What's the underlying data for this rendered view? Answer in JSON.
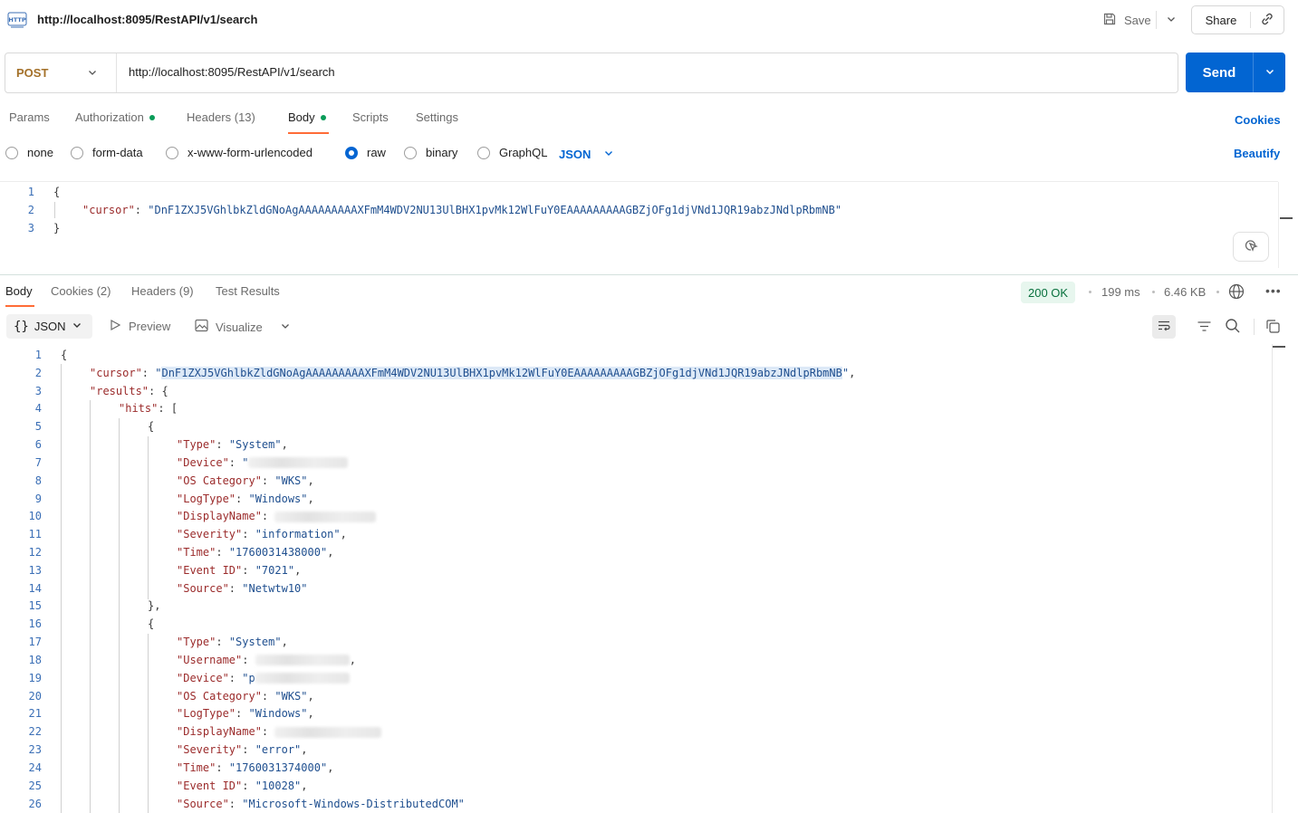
{
  "header": {
    "title": "http://localhost:8095/RestAPI/v1/search",
    "save_label": "Save",
    "share_label": "Share"
  },
  "request": {
    "method": "POST",
    "url": "http://localhost:8095/RestAPI/v1/search",
    "send_label": "Send",
    "tabs": [
      {
        "label": "Params",
        "dot": false
      },
      {
        "label": "Authorization",
        "dot": true
      },
      {
        "label": "Headers (13)",
        "dot": false
      },
      {
        "label": "Body",
        "dot": true
      },
      {
        "label": "Scripts",
        "dot": false
      },
      {
        "label": "Settings",
        "dot": false
      }
    ],
    "active_tab": "Body",
    "cookies_label": "Cookies",
    "body_modes": [
      "none",
      "form-data",
      "x-www-form-urlencoded",
      "raw",
      "binary",
      "GraphQL"
    ],
    "selected_mode": "raw",
    "language": "JSON",
    "beautify_label": "Beautify",
    "body_lines": [
      {
        "n": "1",
        "indent": 0,
        "text": "{"
      },
      {
        "n": "2",
        "indent": 1,
        "key": "cursor",
        "value": "DnF1ZXJ5VGhlbkZldGNoAgAAAAAAAAAXFmM4WDV2NU13UlBHX1pvMk12WlFuY0EAAAAAAAAAGBZjOFg1djVNd1JQR19abzJNdlpRbmNB",
        "trail": ""
      },
      {
        "n": "3",
        "indent": 0,
        "text": "}"
      }
    ]
  },
  "response": {
    "tabs": [
      "Body",
      "Cookies (2)",
      "Headers (9)",
      "Test Results"
    ],
    "active_tab": "Body",
    "status": "200 OK",
    "time": "199 ms",
    "size": "6.46 KB",
    "format": "JSON",
    "preview_label": "Preview",
    "visualize_label": "Visualize",
    "lines": [
      {
        "n": "1",
        "indent": 0,
        "text": "{"
      },
      {
        "n": "2",
        "indent": 1,
        "key": "cursor",
        "value": "DnF1ZXJ5VGhlbkZldGNoAgAAAAAAAAAXFmM4WDV2NU13UlBHX1pvMk12WlFuY0EAAAAAAAAAGBZjOFg1djVNd1JQR19abzJNdlpRbmNB",
        "trail": ",",
        "selected": true
      },
      {
        "n": "3",
        "indent": 1,
        "key": "results",
        "raw": "{"
      },
      {
        "n": "4",
        "indent": 2,
        "key": "hits",
        "raw": "["
      },
      {
        "n": "5",
        "indent": 3,
        "text": "{"
      },
      {
        "n": "6",
        "indent": 4,
        "key": "Type",
        "value": "System",
        "trail": ","
      },
      {
        "n": "7",
        "indent": 4,
        "key": "Device",
        "value": "",
        "trail": "",
        "redacted": 110
      },
      {
        "n": "8",
        "indent": 4,
        "key": "OS Category",
        "value": "WKS",
        "trail": ","
      },
      {
        "n": "9",
        "indent": 4,
        "key": "LogType",
        "value": "Windows",
        "trail": ","
      },
      {
        "n": "10",
        "indent": 4,
        "key": "DisplayName",
        "redacted_only": 112
      },
      {
        "n": "11",
        "indent": 4,
        "key": "Severity",
        "value": "information",
        "trail": ","
      },
      {
        "n": "12",
        "indent": 4,
        "key": "Time",
        "value": "1760031438000",
        "trail": ","
      },
      {
        "n": "13",
        "indent": 4,
        "key": "Event ID",
        "value": "7021",
        "trail": ","
      },
      {
        "n": "14",
        "indent": 4,
        "key": "Source",
        "value": "Netwtw10",
        "trail": ""
      },
      {
        "n": "15",
        "indent": 3,
        "text": "},"
      },
      {
        "n": "16",
        "indent": 3,
        "text": "{"
      },
      {
        "n": "17",
        "indent": 4,
        "key": "Type",
        "value": "System",
        "trail": ","
      },
      {
        "n": "18",
        "indent": 4,
        "key": "Username",
        "redacted_only": 104,
        "after": ","
      },
      {
        "n": "19",
        "indent": 4,
        "key": "Device",
        "value": "p",
        "trail": "",
        "redacted": 104
      },
      {
        "n": "20",
        "indent": 4,
        "key": "OS Category",
        "value": "WKS",
        "trail": ","
      },
      {
        "n": "21",
        "indent": 4,
        "key": "LogType",
        "value": "Windows",
        "trail": ","
      },
      {
        "n": "22",
        "indent": 4,
        "key": "DisplayName",
        "redacted_only": 118
      },
      {
        "n": "23",
        "indent": 4,
        "key": "Severity",
        "value": "error",
        "trail": ","
      },
      {
        "n": "24",
        "indent": 4,
        "key": "Time",
        "value": "1760031374000",
        "trail": ","
      },
      {
        "n": "25",
        "indent": 4,
        "key": "Event ID",
        "value": "10028",
        "trail": ","
      },
      {
        "n": "26",
        "indent": 4,
        "key": "Source",
        "value": "Microsoft-Windows-DistributedCOM",
        "trail": ""
      }
    ]
  },
  "icons": {
    "http": "http-icon",
    "save": "save-icon",
    "link": "link-icon",
    "caret": "chevron-down-icon",
    "globe": "globe-icon",
    "more": "more-horizontal-icon",
    "wrap": "wrap-lines-icon",
    "filter": "filter-icon",
    "search": "search-icon",
    "copy": "copy-icon",
    "preview": "play-icon",
    "visualize": "image-icon",
    "magic": "magic-cursor-icon"
  },
  "colors": {
    "accent": "#0265d2",
    "method": "#a4712a",
    "tab_underline": "#ff6c37",
    "status_bg": "#e7f6ee",
    "status_text": "#08703d",
    "json_key": "#9b2b2b",
    "json_string": "#1f4f8f"
  }
}
